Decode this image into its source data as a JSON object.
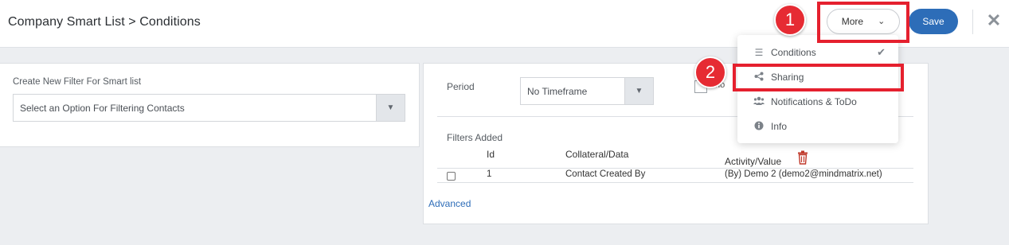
{
  "header": {
    "title": "Company Smart List > Conditions",
    "more_label": "More",
    "save_label": "Save",
    "close_glyph": "✕"
  },
  "annotations": [
    "1",
    "2"
  ],
  "menu": {
    "items": [
      {
        "label": "Conditions",
        "icon": "list-icon",
        "selected": true
      },
      {
        "label": "Sharing",
        "icon": "share-icon",
        "selected": false
      },
      {
        "label": "Notifications & ToDo",
        "icon": "users-icon",
        "selected": false
      },
      {
        "label": "Info",
        "icon": "info-icon",
        "selected": false
      }
    ]
  },
  "filter_panel": {
    "label": "Create New Filter For Smart list",
    "select_value": "Select an Option For Filtering Contacts"
  },
  "conditions_panel": {
    "period_label": "Period",
    "period_value": "No Timeframe",
    "partial_label": "ho",
    "filters_added_label": "Filters Added",
    "columns": [
      "Id",
      "Collateral/Data",
      "Activity/Value"
    ],
    "rows": [
      {
        "id": "1",
        "collateral": "Contact Created By",
        "activity": "(By) Demo 2 (demo2@mindmatrix.net)"
      }
    ],
    "advanced_link": "Advanced"
  },
  "colors": {
    "accent": "#2d6db8",
    "callout": "#e62b33",
    "trash": "#c0392b"
  }
}
